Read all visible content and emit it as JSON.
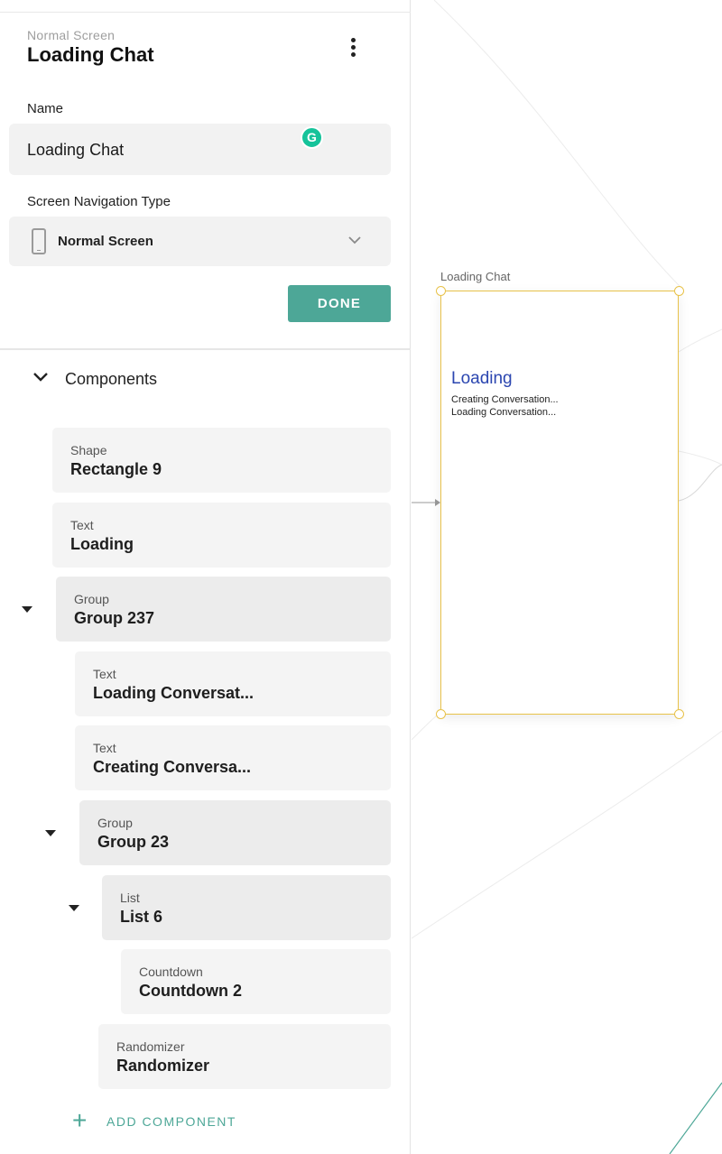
{
  "panel": {
    "subtitle": "Normal Screen",
    "title": "Loading Chat",
    "name_label": "Name",
    "name_value": "Loading Chat",
    "grammarly_badge": "G",
    "nav_type_label": "Screen Navigation Type",
    "nav_type_value": "Normal Screen",
    "done_label": "DONE",
    "components_label": "Components",
    "add_component_label": "ADD COMPONENT",
    "components": [
      {
        "type": "Shape",
        "name": "Rectangle 9"
      },
      {
        "type": "Text",
        "name": "Loading"
      },
      {
        "type": "Group",
        "name": "Group 237"
      },
      {
        "type": "Text",
        "name": "Loading Conversat..."
      },
      {
        "type": "Text",
        "name": "Creating Conversa..."
      },
      {
        "type": "Group",
        "name": "Group 23"
      },
      {
        "type": "List",
        "name": "List 6"
      },
      {
        "type": "Countdown",
        "name": "Countdown 2"
      },
      {
        "type": "Randomizer",
        "name": "Randomizer"
      }
    ]
  },
  "canvas": {
    "frame_label": "Loading Chat",
    "preview_heading": "Loading",
    "preview_line1": "Creating Conversation...",
    "preview_line2": "Loading Conversation..."
  },
  "colors": {
    "accent": "#4da797",
    "selection": "#e8c24a",
    "preview_heading": "#2b46b0",
    "grammarly": "#15c39a"
  },
  "icons": [
    "kebab-menu-icon",
    "phone-icon",
    "chevron-down-icon",
    "collapse-chevron-icon",
    "caret-down-icon",
    "plus-icon",
    "grammarly-icon"
  ]
}
